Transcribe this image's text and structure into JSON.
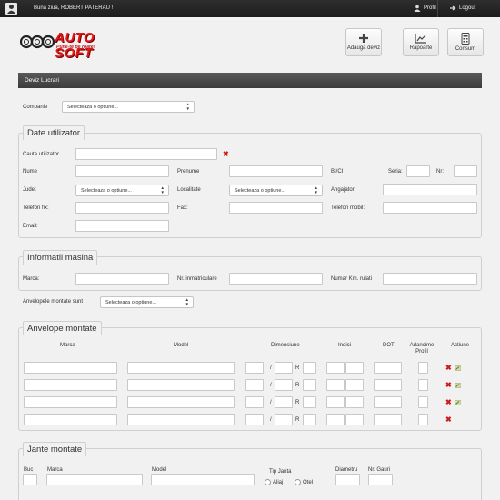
{
  "topbar": {
    "greeting": "Buna ziua, ROBERT PATERAU !",
    "profile": "Profil",
    "logout": "Logout"
  },
  "logo": {
    "name": "AUTO SOFT",
    "slogan": "Pune-te pe roate!"
  },
  "header_buttons": {
    "add_quote": "Adauga deviz",
    "reports": "Rapoarte",
    "consumption": "Consum"
  },
  "panel": {
    "title": "Deviz Lucrari"
  },
  "company": {
    "label": "Companie",
    "select": "Selecteaza o optiune..."
  },
  "user_section": {
    "title": "Date utilizator",
    "search_label": "Cauta utilizator",
    "name": "Nume",
    "first_name": "Prenume",
    "id_card": "BI/CI",
    "series": "Seria:",
    "number": "Nr:",
    "county": "Judet",
    "county_select": "Selecteaza o optiune...",
    "city": "Localitate",
    "city_select": "Selecteaza o optiune...",
    "employer": "Angajator",
    "landline": "Telefon fix:",
    "fax": "Fax:",
    "mobile": "Telefon mobil:",
    "email": "Email:"
  },
  "car_section": {
    "title": "Informatii masina",
    "brand": "Marca:",
    "plate": "Nr. inmatriculare",
    "km": "Numar Km. rulati",
    "tires_label": "Anvelopele montate sunt",
    "tires_select": "Selecteaza o optiune..."
  },
  "tires_section": {
    "title": "Anvelope montate",
    "columns": {
      "brand": "Marca",
      "model": "Model",
      "dimensions": "Dimensiune",
      "indices": "Indici",
      "dot": "DOT",
      "depth_line1": "Adancime",
      "depth_line2": "Profil",
      "actions": "Actiune"
    },
    "separator": "/",
    "r_label": "R",
    "delete_icon": "✖"
  },
  "rims_section": {
    "title": "Jante montate",
    "qty": "Buc",
    "brand": "Marca",
    "model": "Model",
    "rim_type": "Tip Janta",
    "alloy": "Aliaj",
    "steel": "Otel",
    "diameter": "Diametru",
    "bolts": "Nr. Gauri"
  },
  "colors": {
    "accent_red": "#d01818",
    "topbar": "#222222",
    "panel_bar": "#4a4a4a"
  }
}
